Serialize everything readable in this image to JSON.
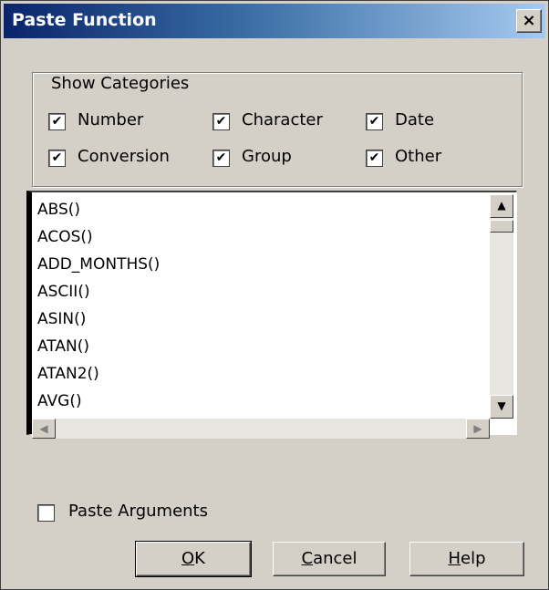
{
  "dialog": {
    "title": "Paste Function",
    "close_glyph": "×"
  },
  "categories": {
    "legend": "Show Categories",
    "items": [
      {
        "label": "Number",
        "checked": true
      },
      {
        "label": "Character",
        "checked": true
      },
      {
        "label": "Date",
        "checked": true
      },
      {
        "label": "Conversion",
        "checked": true
      },
      {
        "label": "Group",
        "checked": true
      },
      {
        "label": "Other",
        "checked": true
      }
    ]
  },
  "functions": [
    "ABS()",
    "ACOS()",
    "ADD_MONTHS()",
    "ASCII()",
    "ASIN()",
    "ATAN()",
    "ATAN2()",
    "AVG()"
  ],
  "paste_arguments": {
    "label": "Paste Arguments",
    "checked": false
  },
  "buttons": {
    "ok": {
      "label": "OK",
      "mnemonic": "O"
    },
    "cancel": {
      "label": "Cancel",
      "mnemonic": "C"
    },
    "help": {
      "label": "Help",
      "mnemonic": "H"
    }
  }
}
